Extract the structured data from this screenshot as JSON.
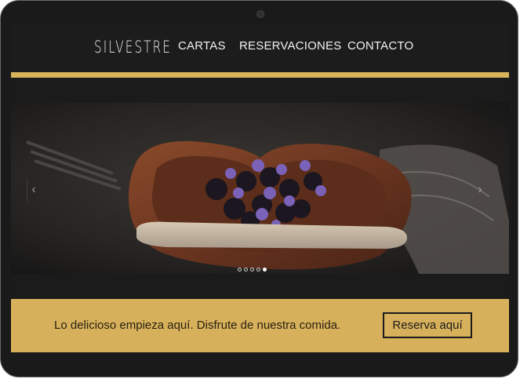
{
  "header": {
    "logo": "SILVESTRE",
    "nav": [
      "CARTAS",
      "RESERVACIONES",
      "CONTACTO"
    ]
  },
  "hero": {
    "image_icon": "dessert-plate-photo",
    "prev_icon": "chevron-left-icon",
    "next_icon": "chevron-right-icon",
    "slide_count": 5,
    "active_slide": 5
  },
  "cta": {
    "text": "Lo delicioso empieza aquí. Disfrute de nuestra comida.",
    "button": "Reserva aquí"
  },
  "colors": {
    "accent_gold": "#d9b25c",
    "background_dark": "#1b1b1b"
  }
}
